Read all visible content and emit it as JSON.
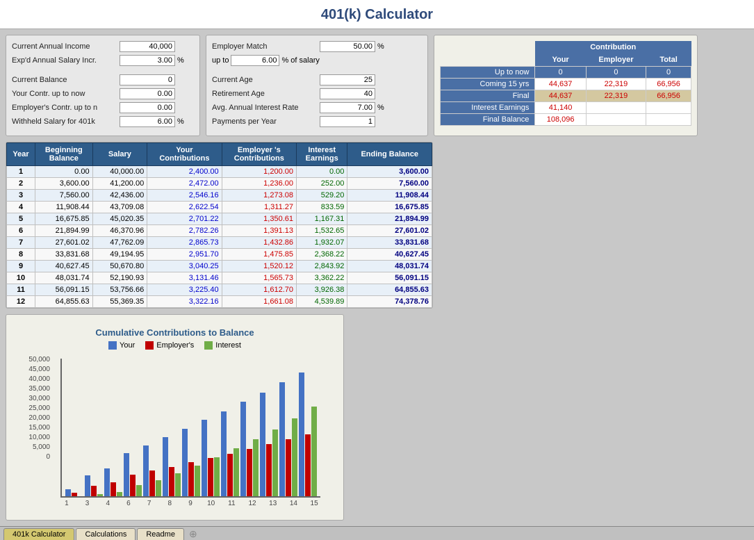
{
  "title": "401(k) Calculator",
  "tabs": [
    {
      "label": "401k Calculator",
      "active": true
    },
    {
      "label": "Calculations",
      "active": false
    },
    {
      "label": "Readme",
      "active": false
    }
  ],
  "inputs": {
    "current_annual_income_label": "Current Annual Income",
    "current_annual_income_value": "40,000",
    "expd_salary_increase_label": "Exp'd Annual Salary Incr.",
    "expd_salary_increase_value": "3.00",
    "expd_salary_pct": "%",
    "current_balance_label": "Current Balance",
    "current_balance_value": "0",
    "your_contrib_label": "Your Contr. up to now",
    "your_contrib_value": "0.00",
    "employer_contrib_label": "Employer's Contr. up to n",
    "employer_contrib_value": "0.00",
    "withheld_salary_label": "Withheld Salary for 401k",
    "withheld_salary_value": "6.00",
    "withheld_salary_pct": "%"
  },
  "employer_match": {
    "label": "Employer Match",
    "value": "50.00",
    "pct": "%",
    "up_to_label": "up to",
    "up_to_value": "6.00",
    "of_salary": "% of salary"
  },
  "retirement": {
    "current_age_label": "Current Age",
    "current_age_value": "25",
    "retirement_age_label": "Retirement Age",
    "retirement_age_value": "40",
    "interest_rate_label": "Avg. Annual Interest Rate",
    "interest_rate_value": "7.00",
    "interest_rate_pct": "%",
    "payments_label": "Payments per Year",
    "payments_value": "1"
  },
  "contribution_table": {
    "header_contribution": "Contribution",
    "col_your": "Your",
    "col_employer": "Employer",
    "col_total": "Total",
    "row_uptonow": {
      "label": "Up to now",
      "your": "0",
      "employer": "0",
      "total": "0"
    },
    "row_coming": {
      "label": "Coming 15 yrs",
      "your": "44,637",
      "employer": "22,319",
      "total": "66,956"
    },
    "row_final": {
      "label": "Final",
      "your": "44,637",
      "employer": "22,319",
      "total": "66,956"
    },
    "row_interest": {
      "label": "Interest Earnings",
      "value": "41,140"
    },
    "row_finalbal": {
      "label": "Final Balance",
      "value": "108,096"
    }
  },
  "data_table": {
    "headers": [
      "Year",
      "Beginning Balance",
      "Salary",
      "Your Contributions",
      "Employer 's Contributions",
      "Interest Earnings",
      "Ending Balance"
    ],
    "rows": [
      {
        "year": "1",
        "begin": "0.00",
        "salary": "40,000.00",
        "your": "2,400.00",
        "employer": "1,200.00",
        "interest": "0.00",
        "ending": "3,600.00"
      },
      {
        "year": "2",
        "begin": "3,600.00",
        "salary": "41,200.00",
        "your": "2,472.00",
        "employer": "1,236.00",
        "interest": "252.00",
        "ending": "7,560.00"
      },
      {
        "year": "3",
        "begin": "7,560.00",
        "salary": "42,436.00",
        "your": "2,546.16",
        "employer": "1,273.08",
        "interest": "529.20",
        "ending": "11,908.44"
      },
      {
        "year": "4",
        "begin": "11,908.44",
        "salary": "43,709.08",
        "your": "2,622.54",
        "employer": "1,311.27",
        "interest": "833.59",
        "ending": "16,675.85"
      },
      {
        "year": "5",
        "begin": "16,675.85",
        "salary": "45,020.35",
        "your": "2,701.22",
        "employer": "1,350.61",
        "interest": "1,167.31",
        "ending": "21,894.99"
      },
      {
        "year": "6",
        "begin": "21,894.99",
        "salary": "46,370.96",
        "your": "2,782.26",
        "employer": "1,391.13",
        "interest": "1,532.65",
        "ending": "27,601.02"
      },
      {
        "year": "7",
        "begin": "27,601.02",
        "salary": "47,762.09",
        "your": "2,865.73",
        "employer": "1,432.86",
        "interest": "1,932.07",
        "ending": "33,831.68"
      },
      {
        "year": "8",
        "begin": "33,831.68",
        "salary": "49,194.95",
        "your": "2,951.70",
        "employer": "1,475.85",
        "interest": "2,368.22",
        "ending": "40,627.45"
      },
      {
        "year": "9",
        "begin": "40,627.45",
        "salary": "50,670.80",
        "your": "3,040.25",
        "employer": "1,520.12",
        "interest": "2,843.92",
        "ending": "48,031.74"
      },
      {
        "year": "10",
        "begin": "48,031.74",
        "salary": "52,190.93",
        "your": "3,131.46",
        "employer": "1,565.73",
        "interest": "3,362.22",
        "ending": "56,091.15"
      },
      {
        "year": "11",
        "begin": "56,091.15",
        "salary": "53,756.66",
        "your": "3,225.40",
        "employer": "1,612.70",
        "interest": "3,926.38",
        "ending": "64,855.63"
      },
      {
        "year": "12",
        "begin": "64,855.63",
        "salary": "55,369.35",
        "your": "3,322.16",
        "employer": "1,661.08",
        "interest": "4,539.89",
        "ending": "74,378.76"
      }
    ]
  },
  "chart": {
    "title": "Cumulative Contributions to Balance",
    "legend": {
      "your_label": "Your",
      "employer_label": "Employer's",
      "interest_label": "Interest"
    },
    "y_axis": [
      "50,000",
      "45,000",
      "40,000",
      "35,000",
      "30,000",
      "25,000",
      "20,000",
      "15,000",
      "10,000",
      "5,000",
      "0"
    ],
    "x_labels": [
      "1",
      "3",
      "4",
      "6",
      "7",
      "8",
      "9",
      "10",
      "11",
      "12",
      "13",
      "14",
      "15"
    ],
    "bars": [
      {
        "year": "1",
        "your": 2400,
        "employer": 1200,
        "interest": 0
      },
      {
        "year": "3",
        "your": 7418,
        "employer": 3709,
        "interest": 781
      },
      {
        "year": "4",
        "your": 10040,
        "employer": 5020,
        "interest": 1614
      },
      {
        "year": "6",
        "your": 15400,
        "employer": 7700,
        "interest": 3897
      },
      {
        "year": "7",
        "your": 18266,
        "employer": 9133,
        "interest": 5829
      },
      {
        "year": "8",
        "your": 21218,
        "employer": 10609,
        "interest": 8197
      },
      {
        "year": "9",
        "your": 24258,
        "employer": 12129,
        "interest": 11041
      },
      {
        "year": "10",
        "your": 27389,
        "employer": 13695,
        "interest": 14007
      },
      {
        "year": "11",
        "your": 30614,
        "employer": 15307,
        "interest": 17135
      },
      {
        "year": "12",
        "your": 33936,
        "employer": 16968,
        "interest": 20475
      },
      {
        "year": "13",
        "your": 37361,
        "employer": 18681,
        "interest": 24069
      },
      {
        "year": "14",
        "your": 40896,
        "employer": 20448,
        "interest": 27961
      },
      {
        "year": "15",
        "your": 44547,
        "employer": 22274,
        "interest": 32192
      }
    ],
    "max_value": 50000
  }
}
